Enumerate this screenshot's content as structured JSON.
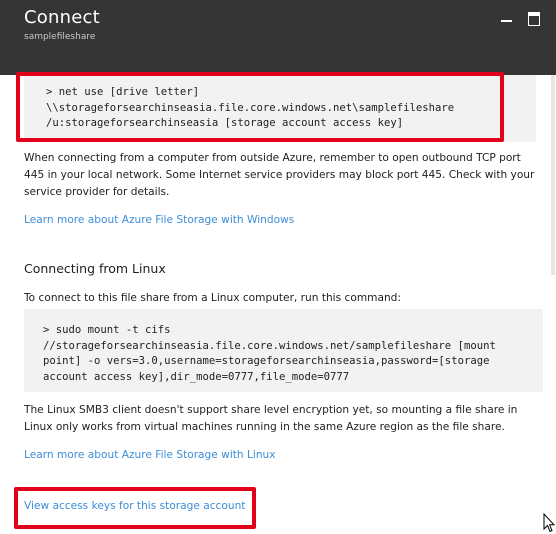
{
  "header": {
    "title": "Connect",
    "subtitle": "samplefileshare"
  },
  "windows_section": {
    "command": "> net use [drive letter]\n\\\\storageforsearchinseasia.file.core.windows.net\\samplefileshare\n/u:storageforsearchinseasia [storage account access key]",
    "note": "When connecting from a computer from outside Azure, remember to open outbound TCP port 445 in your local network. Some Internet service providers may block port 445. Check with your service provider for details.",
    "link": "Learn more about Azure File Storage with Windows"
  },
  "linux_section": {
    "heading": "Connecting from Linux",
    "intro": "To connect to this file share from a Linux computer, run this command:",
    "command": "> sudo mount -t cifs\n//storageforsearchinseasia.file.core.windows.net/samplefileshare [mount\npoint] -o vers=3.0,username=storageforsearchinseasia,password=[storage\naccount access key],dir_mode=0777,file_mode=0777",
    "note": "The Linux SMB3 client doesn't support share level encryption yet, so mounting a file share in Linux only works from virtual machines running in the same Azure region as the file share.",
    "link": "Learn more about Azure File Storage with Linux"
  },
  "access_keys_link": "View access keys for this storage account",
  "colors": {
    "header_bg": "#353535",
    "link": "#3c8ed8",
    "highlight": "#e3001b",
    "code_bg": "#f2f2f2"
  },
  "icons": {
    "minimize": "minimize-icon",
    "maximize": "maximize-icon",
    "cursor": "mouse-pointer-icon"
  }
}
